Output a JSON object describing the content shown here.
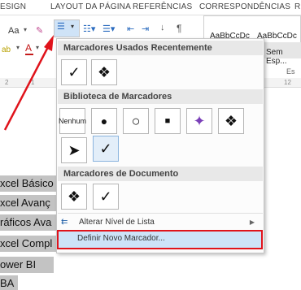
{
  "ribbon": {
    "tabs": [
      "ESIGN",
      "LAYOUT DA PÁGINA",
      "REFERÊNCIAS",
      "CORRESPONDÊNCIAS",
      "R"
    ],
    "font_size_btn": "Aa",
    "style_samples": [
      "AaBbCcDc",
      "AaBbCcDc"
    ],
    "style_name": "Sem Esp...",
    "group_label": "Es",
    "ruler_marks": [
      "2",
      "1",
      "12"
    ]
  },
  "menu": {
    "recent_header": "Marcadores Usados Recentemente",
    "library_header": "Biblioteca de Marcadores",
    "document_header": "Marcadores de Documento",
    "none_label": "Nenhum",
    "change_level": "Alterar Nível de Lista",
    "define_new": "Definir Novo Marcador...",
    "symbols": {
      "check": "✓",
      "diamond4": "❖",
      "dot": "●",
      "circle": "○",
      "square": "■",
      "arrow": "➤",
      "star4": "✦"
    }
  },
  "document": {
    "lines": [
      "xcel Básico",
      "xcel Avanç",
      "ráficos Ava",
      "xcel Compl",
      "ower BI",
      "BA"
    ]
  },
  "colors": {
    "highlight_border": "#e0131b",
    "selection_blue": "#cde3f8",
    "accent_arrow": "#e0131b"
  }
}
